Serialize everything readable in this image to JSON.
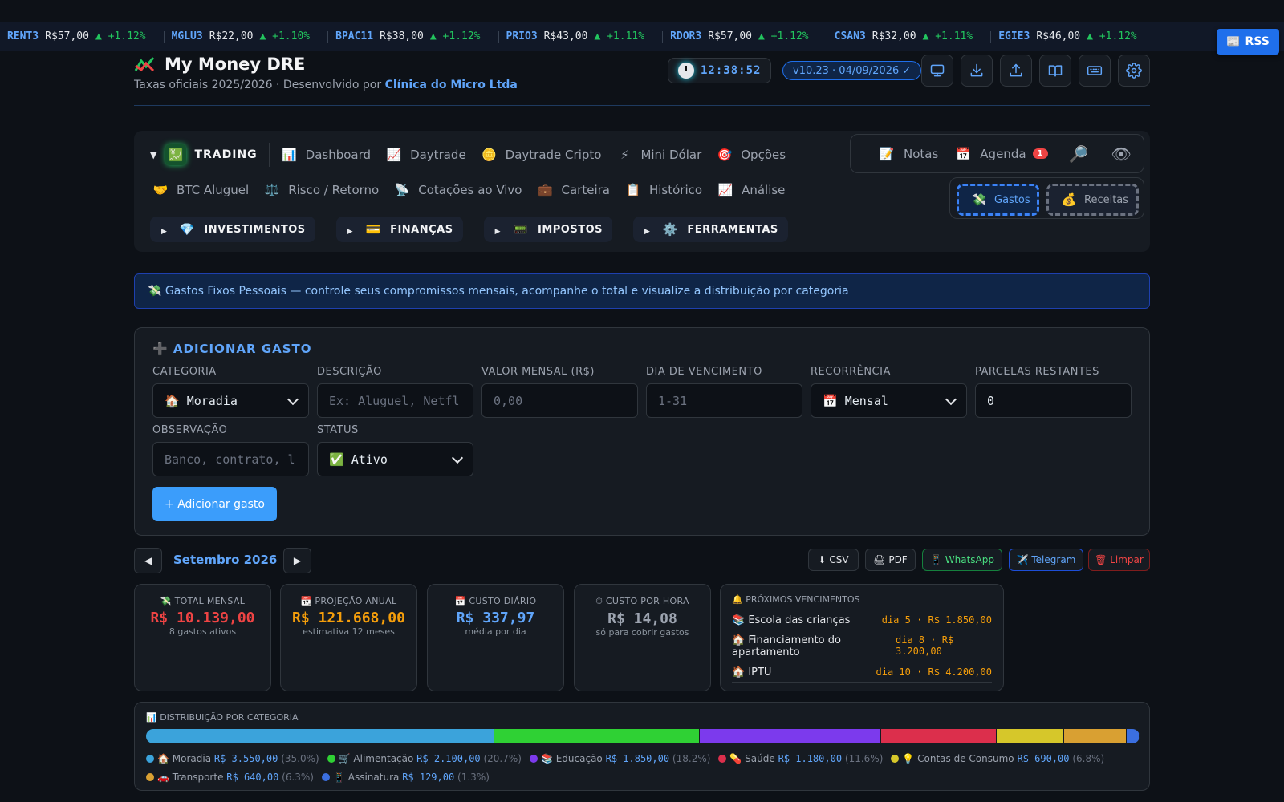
{
  "ticker": [
    {
      "symbol": "RENT3",
      "price": "R$57,00",
      "change": "▲ +1.12%"
    },
    {
      "symbol": "MGLU3",
      "price": "R$22,00",
      "change": "▲ +1.10%"
    },
    {
      "symbol": "BPAC11",
      "price": "R$38,00",
      "change": "▲ +1.12%"
    },
    {
      "symbol": "PRIO3",
      "price": "R$43,00",
      "change": "▲ +1.11%"
    },
    {
      "symbol": "RDOR3",
      "price": "R$57,00",
      "change": "▲ +1.12%"
    },
    {
      "symbol": "CSAN3",
      "price": "R$32,00",
      "change": "▲ +1.11%"
    },
    {
      "symbol": "EGIE3",
      "price": "R$46,00",
      "change": "▲ +1.12%"
    }
  ],
  "rss_label": "RSS",
  "header": {
    "title": "My Money DRE",
    "subtitle_prefix": "Taxas oficiais 2025/2026 · Desenvolvido por",
    "subtitle_company": "Clínica do Micro Ltda",
    "clock": "12:38:52",
    "version": "v10.23 · 04/09/2026 ✓"
  },
  "nav": {
    "trading": {
      "label": "TRADING",
      "icon": "💹",
      "caret": "▼"
    },
    "row1": [
      {
        "label": "Dashboard",
        "icon": "📊"
      },
      {
        "label": "Daytrade",
        "icon": "📈"
      },
      {
        "label": "Daytrade Cripto",
        "icon": "🪙"
      },
      {
        "label": "Mini Dólar",
        "icon": "⚡"
      },
      {
        "label": "Opções",
        "icon": "🎯"
      }
    ],
    "row2": [
      {
        "label": "BTC Aluguel",
        "icon": "🤝"
      },
      {
        "label": "Risco / Retorno",
        "icon": "⚖️"
      },
      {
        "label": "Cotações ao Vivo",
        "icon": "📡"
      },
      {
        "label": "Carteira",
        "icon": "💼"
      },
      {
        "label": "Histórico",
        "icon": "📋"
      },
      {
        "label": "Análise",
        "icon": "📈"
      }
    ],
    "groups": [
      {
        "label": "INVESTIMENTOS",
        "icon": "💎",
        "caret": "▶"
      },
      {
        "label": "FINANÇAS",
        "icon": "💳",
        "caret": "▶"
      },
      {
        "label": "IMPOSTOS",
        "icon": "📟",
        "caret": "▶"
      },
      {
        "label": "FERRAMENTAS",
        "icon": "⚙️",
        "caret": "▶"
      }
    ],
    "quick": {
      "notes": {
        "label": "Notas",
        "icon": "📝"
      },
      "agenda": {
        "label": "Agenda",
        "icon": "📅",
        "badge": "1"
      },
      "search_icon": "🔎",
      "eye_icon": "👁"
    },
    "gastos": {
      "label": "Gastos",
      "icon": "💸"
    },
    "receitas": {
      "label": "Receitas",
      "icon": "💰"
    }
  },
  "banner": "💸 Gastos Fixos Pessoais — controle seus compromissos mensais, acompanhe o total e visualize a distribuição por categoria",
  "form": {
    "title": "➕ ADICIONAR GASTO",
    "categoria": {
      "label": "CATEGORIA",
      "value": "🏠 Moradia"
    },
    "descricao": {
      "label": "DESCRIÇÃO",
      "placeholder": "Ex: Aluguel, Netfl"
    },
    "valor": {
      "label": "VALOR MENSAL (R$)",
      "placeholder": "0,00"
    },
    "dia": {
      "label": "DIA DE VENCIMENTO",
      "placeholder": "1-31"
    },
    "recorrencia": {
      "label": "RECORRÊNCIA",
      "value": "📅 Mensal"
    },
    "parcelas": {
      "label": "PARCELAS RESTANTES",
      "value": "0"
    },
    "observacao": {
      "label": "OBSERVAÇÃO",
      "placeholder": "Banco, contrato, l"
    },
    "status": {
      "label": "STATUS",
      "value": "✅ Ativo"
    },
    "submit": "+ Adicionar gasto"
  },
  "month": {
    "prev": "◀",
    "label": "Setembro 2026",
    "next": "▶"
  },
  "exports": {
    "csv": "⬇ CSV",
    "pdf": "🖨 PDF",
    "whatsapp": "📱 WhatsApp",
    "telegram": "✈️ Telegram",
    "clear": "🗑 Limpar"
  },
  "stats": {
    "total": {
      "label": "💸 TOTAL MENSAL",
      "value": "R$ 10.139,00",
      "sub": "8 gastos ativos"
    },
    "annual": {
      "label": "📆 PROJEÇÃO ANUAL",
      "value": "R$ 121.668,00",
      "sub": "estimativa 12 meses"
    },
    "daily": {
      "label": "📅 CUSTO DIÁRIO",
      "value": "R$ 337,97",
      "sub": "média por dia"
    },
    "hourly": {
      "label": "⏱ CUSTO POR HORA",
      "value": "R$ 14,08",
      "sub": "só para cobrir gastos"
    }
  },
  "due": {
    "label": "🔔 PRÓXIMOS VENCIMENTOS",
    "items": [
      {
        "name": "📚 Escola das crianças",
        "when": "dia 5 · R$ 1.850,00"
      },
      {
        "name": "🏠 Financiamento do apartamento",
        "when": "dia 8 · R$ 3.200,00"
      },
      {
        "name": "🏠 IPTU",
        "when": "dia 10 · R$ 4.200,00"
      }
    ]
  },
  "distribution": {
    "label": "📊 DISTRIBUIÇÃO POR CATEGORIA",
    "categories": [
      {
        "name": "🏠 Moradia",
        "amount": "R$ 3.550,00",
        "pct_text": "(35.0%)",
        "share": 35.0,
        "color": "#3ba3db"
      },
      {
        "name": "🛒 Alimentação",
        "amount": "R$ 2.100,00",
        "pct_text": "(20.7%)",
        "share": 20.7,
        "color": "#2fd134"
      },
      {
        "name": "📚 Educação",
        "amount": "R$ 1.850,00",
        "pct_text": "(18.2%)",
        "share": 18.2,
        "color": "#7c3aed"
      },
      {
        "name": "💊 Saúde",
        "amount": "R$ 1.180,00",
        "pct_text": "(11.6%)",
        "share": 11.6,
        "color": "#dc2f4c"
      },
      {
        "name": "💡 Contas de Consumo",
        "amount": "R$ 690,00",
        "pct_text": "(6.8%)",
        "share": 6.8,
        "color": "#d6c72a"
      },
      {
        "name": "🚗 Transporte",
        "amount": "R$ 640,00",
        "pct_text": "(6.3%)",
        "share": 6.3,
        "color": "#d9a032"
      },
      {
        "name": "📱 Assinatura",
        "amount": "R$ 129,00",
        "pct_text": "(1.3%)",
        "share": 1.3,
        "color": "#3b6fe0"
      }
    ]
  },
  "colors": {
    "accent": "#60a5fa",
    "danger": "#ef4444",
    "warning": "#f59e0b",
    "success": "#22c55e"
  }
}
